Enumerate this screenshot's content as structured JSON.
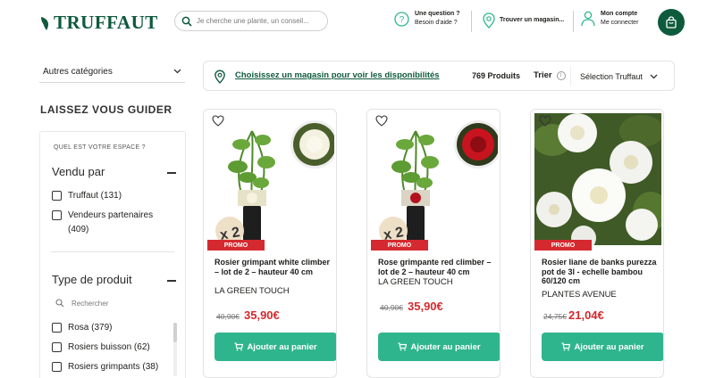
{
  "header": {
    "logo": "TRUFFAUT",
    "search_placeholder": "Je cherche une plante, un conseil...",
    "help_title": "Une question ?",
    "help_sub": "Besoin d'aide ?",
    "store_label": "Trouver un magasin...",
    "account_title": "Mon compte",
    "account_sub": "Me connecter"
  },
  "sidebar": {
    "categories_label": "Autres catégories",
    "guide_title": "LAISSEZ VOUS GUIDER",
    "space_label": "QUEL EST VOTRE ESPACE ?",
    "sold_by": {
      "title": "Vendu par",
      "options": [
        "Truffaut (131)",
        "Vendeurs partenaires (409)"
      ]
    },
    "product_type": {
      "title": "Type de produit",
      "search_placeholder": "Rechercher",
      "options": [
        "Rosa (379)",
        "Rosiers buisson (62)",
        "Rosiers grimpants (38)"
      ]
    }
  },
  "storebar": {
    "link": "Choisissez un magasin pour voir les disponibilités",
    "count": "769 Produits",
    "sort_label": "Trier",
    "sort_value": "Sélection Truffaut"
  },
  "products": [
    {
      "badge": "PROMO",
      "name": "Rosier grimpant white climber – lot de 2 – hauteur 40 cm",
      "seller": "LA GREEN TOUCH",
      "old_price": "40,90€",
      "price": "35,90€",
      "button": "Ajouter au panier",
      "flower_color": "#f4f1e0",
      "multiplier": "x 2"
    },
    {
      "badge": "PROMO",
      "name": "Rose grimpante red climber – lot de 2 – hauteur 40 cm",
      "seller": "LA GREEN TOUCH",
      "old_price": "40,90€",
      "price": "35,90€",
      "button": "Ajouter au panier",
      "flower_color": "#c8141e",
      "multiplier": "x 2"
    },
    {
      "badge": "PROMO",
      "name": "Rosier liane de banks purezza pot de 3l - echelle bambou 60/120 cm",
      "seller": "PLANTES AVENUE",
      "old_price": "24,75€",
      "price": "21,04€",
      "button": "Ajouter au panier"
    }
  ],
  "colors": {
    "brand": "#0e5a3c",
    "accent": "#2fb58d",
    "promo": "#d42a2f"
  }
}
